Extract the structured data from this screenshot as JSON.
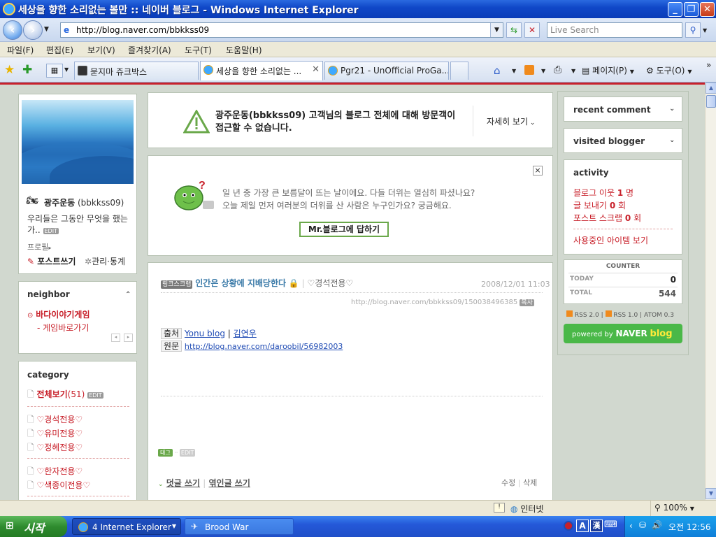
{
  "window": {
    "title": "세상을 향한 소리없는 볼만 :: 네이버 블로그 - Windows Internet Explorer"
  },
  "address": {
    "url": "http://blog.naver.com/bbkkss09",
    "search_placeholder": "Live Search"
  },
  "menu": [
    "파일(F)",
    "편집(E)",
    "보기(V)",
    "즐겨찾기(A)",
    "도구(T)",
    "도움말(H)"
  ],
  "tabs": [
    {
      "label": "묻지마 쥬크박스"
    },
    {
      "label": "세상을 향한 소리없는 ..."
    },
    {
      "label": "Pgr21 - UnOfficial ProGa..."
    }
  ],
  "toolbar_right": {
    "page": "페이지(P)",
    "tools": "도구(O)"
  },
  "profile": {
    "name": "광주운동",
    "id": "(bbkkss09)",
    "intro": "우리들은 그동안 무엇을 했는가..",
    "edit": "EDIT",
    "profile_link": "프로필",
    "write_post": "포스트쓰기",
    "manage": "관리·통계"
  },
  "neighbor": {
    "title": "neighbor",
    "items": [
      "바다이야기게임",
      "- 게임바로가기"
    ]
  },
  "category": {
    "title": "category",
    "all": "전체보기",
    "all_count": "(51)",
    "edit": "EDIT",
    "items": [
      "♡경석전용♡",
      "♡유미전용♡",
      "♡정혜전용♡",
      "♡한자전용♡",
      "♡색종이전용♡"
    ]
  },
  "warning": {
    "text": "광주운동(bbkkss09) 고객님의 블로그 전체에 대해 방문객이 접근할 수 없습니다.",
    "details": "자세히 보기"
  },
  "mr_blog": {
    "line1": "일 년 중 가장 큰 보름달이 뜨는 날이에요. 다들 더위는 열심히 파셨나요?",
    "line2": "오늘 제일 먼저 여러분의 더위를 산 사람은 누구인가요? 궁금해요.",
    "button": "Mr.블로그에 답하기",
    "close": "×"
  },
  "post": {
    "badge": "링크스크랩",
    "title": "인간은 상황에 지배당한다",
    "category": "♡경석전용♡",
    "date": "2008/12/01 11:03",
    "permalink": "http://blog.naver.com/bbkkss09/150038496385",
    "copy": "복사",
    "source_label": "출처",
    "source_blog": "Yonu blog",
    "source_author": "김연우",
    "original_label": "원문",
    "original_url": "http://blog.naver.com/daroobil/56982003",
    "tag_badge": "태그",
    "tag_edit": "EDIT",
    "comment": "덧글 쓰기",
    "trackback": "엮인글 쓰기",
    "modify": "수정",
    "delete": "삭제"
  },
  "right": {
    "recent_comment": "recent comment",
    "visited_blogger": "visited blogger",
    "activity_title": "activity",
    "activity": [
      {
        "label": "블로그 이웃",
        "value": "1",
        "unit": "명"
      },
      {
        "label": "글 보내기",
        "value": "0",
        "unit": "회"
      },
      {
        "label": "포스트 스크랩",
        "value": "0",
        "unit": "회"
      }
    ],
    "items_link": "사용중인 아이템 보기",
    "counter_title": "COUNTER",
    "today_label": "TODAY",
    "today": "0",
    "total_label": "TOTAL",
    "total": "544",
    "rss2": "RSS 2.0",
    "rss1": "RSS 1.0",
    "atom": "ATOM 0.3",
    "powered_prefix": "powered by",
    "powered_brand": "NAVER",
    "powered_blog": "blog"
  },
  "statusbar": {
    "zone": "인터넷",
    "zoom": "100%"
  },
  "taskbar": {
    "start": "시작",
    "items": [
      {
        "label": "4 Internet Explorer"
      },
      {
        "label": "Brood War"
      }
    ],
    "clock": "오전 12:56"
  }
}
